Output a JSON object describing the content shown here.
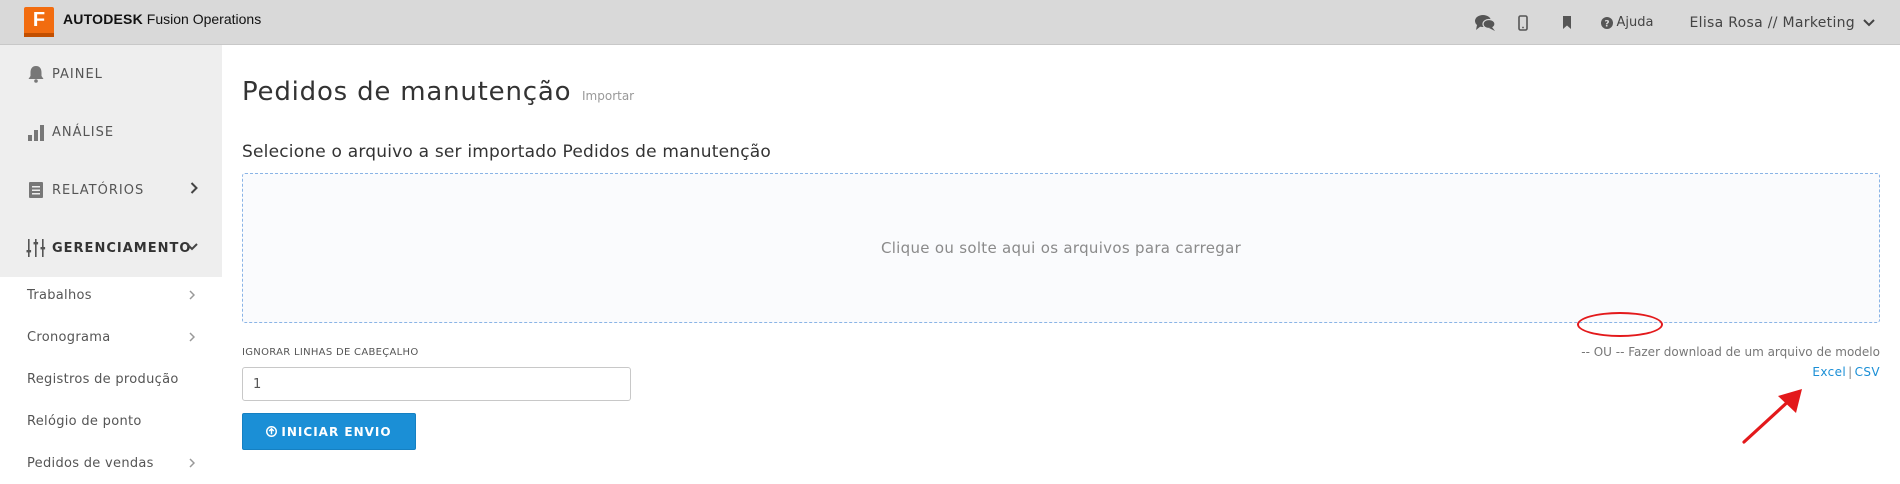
{
  "app": {
    "brand_bold": "AUTODESK",
    "brand_rest": " Fusion Operations",
    "logo_letter": "F",
    "logo_color": "#f26c0f"
  },
  "topbar": {
    "help_label": "Ajuda",
    "user_label": "Elisa Rosa // Marketing",
    "icons": [
      "chat-icon",
      "mobile-icon",
      "bookmark-icon",
      "help-icon",
      "chevron-down-icon"
    ]
  },
  "sidebar": {
    "main_items": [
      {
        "label": "PAINEL",
        "icon": "bell-icon"
      },
      {
        "label": "ANÁLISE",
        "icon": "bar-chart-icon"
      },
      {
        "label": "RELATÓRIOS",
        "icon": "document-icon"
      },
      {
        "label": "GERENCIAMENTO",
        "icon": "sliders-icon"
      }
    ],
    "sub_items": [
      {
        "label": "Trabalhos"
      },
      {
        "label": "Cronograma"
      },
      {
        "label": "Registros de produção"
      },
      {
        "label": "Relógio de ponto"
      },
      {
        "label": "Pedidos de vendas"
      }
    ]
  },
  "main": {
    "title": "Pedidos de manutenção",
    "subtitle": "Importar",
    "section_title": "Selecione o arquivo a ser importado Pedidos de manutenção",
    "dropzone_text": "Clique ou solte aqui os arquivos para carregar",
    "header_rows_label": "IGNORAR LINHAS DE CABEÇALHO",
    "header_rows_value": "1",
    "start_button": "INICIAR ENVIO",
    "template_note": "-- OU -- Fazer download de um arquivo de modelo",
    "excel_link": "Excel",
    "link_separator": "|",
    "csv_link": "CSV"
  },
  "colors": {
    "primary": "#1b8fd6",
    "annotation": "#e3191b",
    "topbar_bg": "#d9d9d9",
    "sidebar_active_bg": "#eeeeee"
  }
}
